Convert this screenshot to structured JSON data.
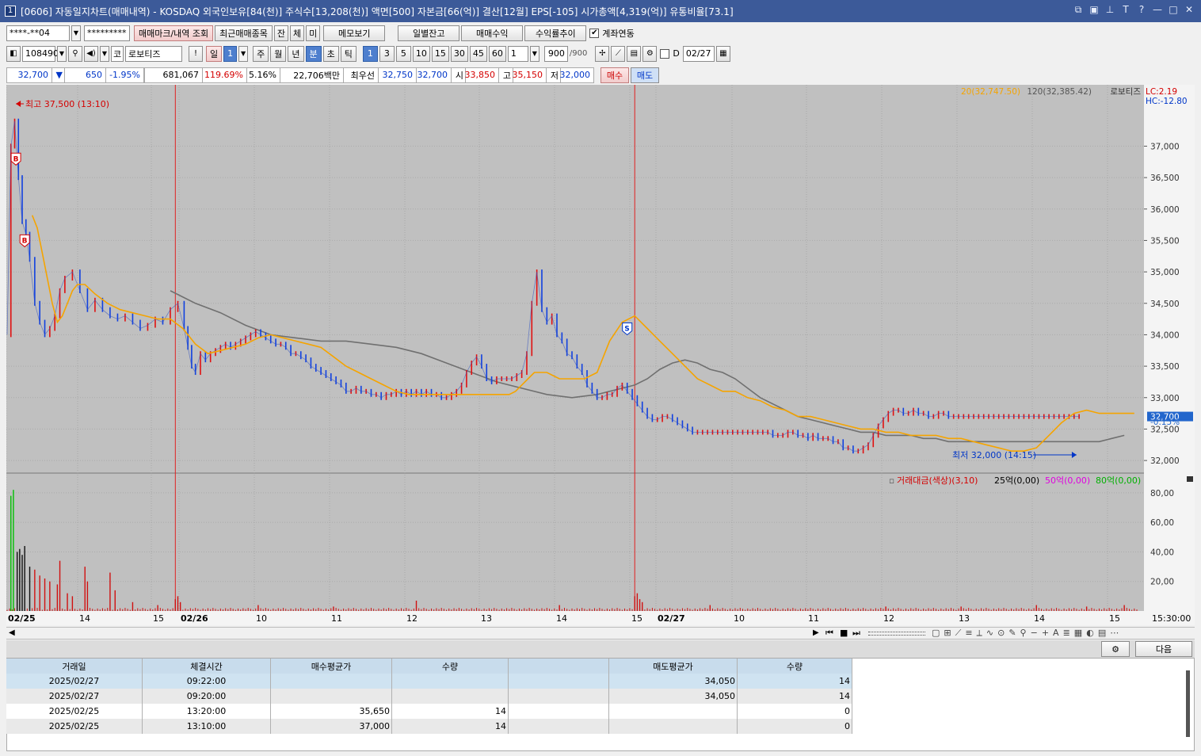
{
  "window": {
    "icon": "1",
    "title": "[0606] 자동일지차트(매매내역) - KOSDAQ 외국인보유[84(천)] 주식수[13,208(천)] 액면[500] 자본금[66(억)] 결산[12월] EPS[-105] 시가총액[4,319(억)] 유통비율[73.1]"
  },
  "toolbar1": {
    "account": "****-**04",
    "password": "*********",
    "mark_btn": "매매마크/내역 조회",
    "recent_btn": "최근매매종목",
    "jan": "잔",
    "che": "체",
    "mi": "미",
    "memo_btn": "메모보기",
    "daily_btn": "일별잔고",
    "profit_btn": "매매수익",
    "rate_btn": "수익률추이",
    "link_check": "✔",
    "link_label": "계좌연동"
  },
  "toolbar2": {
    "code": "108490",
    "market": "코",
    "name": "로보티즈",
    "excl": "!",
    "period_day": "일",
    "period_num": "1",
    "week": "주",
    "month": "월",
    "year": "년",
    "minute": "분",
    "second": "초",
    "tick": "틱",
    "intervals": [
      "1",
      "3",
      "5",
      "10",
      "15",
      "30",
      "45",
      "60"
    ],
    "multi": "1",
    "count": "900",
    "count_max": "/900",
    "d_label": "D",
    "date": "02/27"
  },
  "quote": {
    "price": "32,700",
    "arrow": "▼",
    "change": "650",
    "rate": "-1.95%",
    "volume": "681,067",
    "vol_rate": "119.69%",
    "turnover": "5.16%",
    "amount": "22,706백만",
    "best_label": "최우선",
    "ask": "32,750",
    "bid": "32,700",
    "open_label": "시",
    "open": "33,850",
    "high_label": "고",
    "high": "35,150",
    "low_label": "저",
    "low": "32,000",
    "buy_btn": "매수",
    "sell_btn": "매도"
  },
  "chart_data": {
    "type": "line",
    "title": "",
    "legend": {
      "ma20": "20(32,747.50)",
      "ma120": "120(32,385.42)",
      "name": "로보티즈",
      "lc": "LC:2.19",
      "hc": "HC:-12.80"
    },
    "high_label": "최고 37,500 (13:10)",
    "low_label": "최저 32,000 (14:15)",
    "y_ticks": [
      "37,000",
      "36,500",
      "36,000",
      "35,500",
      "35,000",
      "34,500",
      "34,000",
      "33,500",
      "33,000",
      "32,500",
      "32,000"
    ],
    "y_values": [
      37000,
      36500,
      36000,
      35500,
      35000,
      34500,
      34000,
      33500,
      33000,
      32500,
      32000
    ],
    "ylim": [
      31850,
      37850
    ],
    "current_price_tag": "32,700",
    "current_change_tag": "-0.15%",
    "x_labels": [
      "02/25",
      "14",
      "15",
      "02/26",
      "10",
      "11",
      "12",
      "13",
      "14",
      "15",
      "02/27",
      "10",
      "11",
      "12",
      "13",
      "14",
      "15",
      "15:30:00"
    ],
    "price_series": {
      "t": [
        0,
        3,
        6,
        9,
        12,
        15,
        18,
        22,
        26,
        30,
        34,
        38,
        42,
        46,
        52,
        58,
        64,
        70,
        76,
        82,
        88,
        94,
        100,
        106,
        112,
        118,
        124,
        130,
        136,
        141,
        144,
        147,
        150,
        154,
        158,
        162,
        166,
        170,
        174,
        178,
        182,
        186,
        190,
        194,
        198,
        202,
        206,
        210,
        214,
        218,
        222,
        226,
        230,
        234,
        238,
        242,
        246,
        250,
        254,
        258,
        262,
        266,
        270,
        274,
        278,
        282,
        286,
        290,
        294,
        298,
        302,
        306,
        310,
        314,
        318,
        322,
        326,
        330,
        334,
        338,
        342,
        346,
        350,
        354,
        358,
        362,
        366,
        370,
        374,
        378,
        382,
        386,
        390,
        394,
        398,
        402,
        406,
        410,
        414,
        418,
        422,
        426,
        430,
        434,
        438,
        442,
        446,
        450,
        454,
        458,
        462,
        466,
        470,
        474,
        478,
        482,
        486,
        490,
        494,
        498,
        502,
        506,
        510,
        514,
        518,
        522,
        526,
        530,
        534,
        538,
        542,
        546,
        550,
        554,
        558,
        562,
        566,
        570,
        574,
        578,
        582,
        586,
        590,
        594,
        598,
        602,
        606,
        610,
        614,
        618,
        622,
        626,
        630,
        634,
        638,
        642,
        646,
        650,
        654,
        658,
        662,
        666,
        670,
        674,
        678,
        682,
        686,
        690,
        694,
        698,
        702,
        706,
        710,
        714,
        718,
        722,
        726,
        730,
        734,
        738,
        742,
        746,
        750,
        754,
        758,
        762,
        766,
        770,
        774,
        778,
        782,
        786,
        790,
        794,
        798,
        802,
        806,
        810,
        814,
        818,
        822,
        826,
        830,
        834,
        838,
        842,
        846,
        850,
        854,
        858,
        862,
        866,
        870,
        874,
        878,
        882,
        886,
        890,
        894,
        898
      ],
      "v": [
        34000,
        37000,
        37400,
        36500,
        35800,
        35600,
        35200,
        34500,
        34200,
        34000,
        34100,
        34300,
        34700,
        34900,
        35000,
        34700,
        34400,
        34550,
        34400,
        34300,
        34250,
        34300,
        34200,
        34100,
        34150,
        34250,
        34200,
        34400,
        34500,
        34100,
        33800,
        33500,
        33400,
        33700,
        33600,
        33700,
        33750,
        33800,
        33850,
        33800,
        33850,
        33900,
        33950,
        34000,
        34050,
        34000,
        33950,
        33900,
        33850,
        33850,
        33800,
        33700,
        33700,
        33650,
        33600,
        33500,
        33450,
        33400,
        33350,
        33300,
        33250,
        33200,
        33100,
        33100,
        33150,
        33100,
        33100,
        33050,
        33050,
        33000,
        33050,
        33050,
        33100,
        33050,
        33100,
        33050,
        33100,
        33050,
        33100,
        33050,
        33050,
        33000,
        33000,
        33050,
        33100,
        33200,
        33400,
        33550,
        33650,
        33500,
        33300,
        33250,
        33300,
        33300,
        33300,
        33300,
        33350,
        33400,
        33700,
        34500,
        35000,
        34400,
        34200,
        34300,
        34000,
        33900,
        33700,
        33650,
        33500,
        33400,
        33200,
        33100,
        33000,
        33000,
        33050,
        33050,
        33150,
        33200,
        33100,
        33000,
        32900,
        32800,
        32700,
        32650,
        32650,
        32700,
        32700,
        32650,
        32600,
        32550,
        32500,
        32450,
        32450,
        32450,
        32450,
        32450,
        32450,
        32450,
        32450,
        32450,
        32450,
        32450,
        32450,
        32450,
        32450,
        32450,
        32450,
        32400,
        32400,
        32400,
        32450,
        32450,
        32400,
        32400,
        32350,
        32400,
        32350,
        32350,
        32350,
        32300,
        32300,
        32200,
        32200,
        32150,
        32150,
        32200,
        32250,
        32400,
        32550,
        32650,
        32750,
        32800,
        32800,
        32750,
        32750,
        32800,
        32750,
        32750,
        32700,
        32700,
        32750,
        32750,
        32700,
        32700,
        32700,
        32700,
        32700,
        32700,
        32700,
        32700,
        32700,
        32700,
        32700,
        32700,
        32700,
        32700,
        32700,
        32700,
        32700,
        32700,
        32700,
        32700,
        32700,
        32700,
        32700,
        32700,
        32700,
        32700,
        32700
      ]
    },
    "ma20": {
      "t": [
        20,
        24,
        28,
        32,
        36,
        40,
        44,
        48,
        52,
        56,
        62,
        70,
        80,
        90,
        100,
        110,
        120,
        130,
        140,
        150,
        160,
        170,
        180,
        190,
        200,
        210,
        220,
        230,
        240,
        250,
        260,
        270,
        280,
        290,
        300,
        310,
        320,
        330,
        340,
        350,
        360,
        370,
        380,
        390,
        400,
        405,
        410,
        415,
        420,
        425,
        430,
        435,
        440,
        445,
        450,
        455,
        460,
        470,
        480,
        490,
        500,
        510,
        520,
        530,
        540,
        550,
        560,
        570,
        580,
        590,
        600,
        610,
        620,
        630,
        640,
        650,
        660,
        670,
        680,
        690,
        700,
        710,
        720,
        730,
        740,
        750,
        760,
        770,
        780,
        790,
        800,
        810,
        820,
        830,
        840,
        850,
        860,
        870,
        880,
        890,
        898
      ],
      "v": [
        35900,
        35700,
        35300,
        34900,
        34500,
        34200,
        34300,
        34500,
        34700,
        34800,
        34800,
        34650,
        34500,
        34400,
        34350,
        34300,
        34250,
        34250,
        34100,
        33850,
        33700,
        33750,
        33800,
        33850,
        33950,
        34000,
        33950,
        33900,
        33850,
        33800,
        33650,
        33500,
        33400,
        33300,
        33200,
        33100,
        33050,
        33050,
        33050,
        33050,
        33050,
        33050,
        33050,
        33050,
        33050,
        33100,
        33200,
        33300,
        33400,
        33400,
        33400,
        33350,
        33300,
        33300,
        33300,
        33300,
        33300,
        33400,
        33900,
        34200,
        34300,
        34100,
        33900,
        33700,
        33500,
        33300,
        33200,
        33100,
        33100,
        33000,
        32950,
        32850,
        32800,
        32700,
        32700,
        32650,
        32600,
        32550,
        32500,
        32500,
        32450,
        32450,
        32400,
        32400,
        32400,
        32350,
        32350,
        32300,
        32250,
        32200,
        32150,
        32150,
        32200,
        32400,
        32600,
        32750,
        32800,
        32750,
        32750,
        32750,
        32750
      ]
    },
    "ma120": {
      "t": [
        130,
        150,
        170,
        190,
        210,
        230,
        250,
        270,
        290,
        310,
        330,
        350,
        370,
        390,
        410,
        430,
        450,
        470,
        480,
        490,
        500,
        510,
        520,
        530,
        540,
        550,
        560,
        570,
        580,
        590,
        600,
        610,
        620,
        630,
        640,
        650,
        660,
        670,
        680,
        690,
        700,
        710,
        720,
        730,
        740,
        750,
        760,
        770,
        780,
        790,
        800,
        810,
        820,
        830,
        840,
        850,
        860,
        870,
        880,
        890
      ],
      "v": [
        34700,
        34500,
        34350,
        34150,
        34000,
        33950,
        33900,
        33900,
        33850,
        33800,
        33700,
        33550,
        33400,
        33250,
        33150,
        33050,
        33000,
        33050,
        33100,
        33150,
        33200,
        33300,
        33450,
        33550,
        33600,
        33550,
        33450,
        33400,
        33300,
        33150,
        33000,
        32900,
        32800,
        32700,
        32650,
        32600,
        32550,
        32500,
        32450,
        32450,
        32400,
        32400,
        32400,
        32350,
        32350,
        32300,
        32300,
        32300,
        32300,
        32300,
        32300,
        32300,
        32300,
        32300,
        32300,
        32300,
        32300,
        32300,
        32350,
        32400
      ]
    },
    "markers": [
      {
        "label": "B",
        "t": 7,
        "v": 36800
      },
      {
        "label": "B",
        "t": 14,
        "v": 35500
      },
      {
        "label": "S",
        "t": 494,
        "v": 34100
      }
    ],
    "session_dividers": [
      134,
      500
    ],
    "volume_legend": {
      "box": "▫",
      "name": "거래대금(색상)(3,10)",
      "l25": "25억(0,00)",
      "l50": "50억(0,00)",
      "l80": "80억(0,00)"
    },
    "vol_ticks": [
      "80,00",
      "60,00",
      "40,00",
      "20,00"
    ],
    "vol_tick_values": [
      80,
      60,
      40,
      20
    ],
    "vol_max": 88,
    "volume_spikes": [
      {
        "t": 3,
        "v": 78
      },
      {
        "t": 5,
        "v": 82
      },
      {
        "t": 8,
        "v": 40
      },
      {
        "t": 10,
        "v": 42
      },
      {
        "t": 12,
        "v": 38
      },
      {
        "t": 14,
        "v": 44
      },
      {
        "t": 18,
        "v": 30
      },
      {
        "t": 22,
        "v": 28
      },
      {
        "t": 26,
        "v": 24
      },
      {
        "t": 30,
        "v": 22
      },
      {
        "t": 34,
        "v": 20
      },
      {
        "t": 40,
        "v": 18
      },
      {
        "t": 42,
        "v": 34
      },
      {
        "t": 48,
        "v": 12
      },
      {
        "t": 52,
        "v": 10
      },
      {
        "t": 62,
        "v": 30
      },
      {
        "t": 64,
        "v": 20
      },
      {
        "t": 82,
        "v": 26
      },
      {
        "t": 86,
        "v": 14
      },
      {
        "t": 100,
        "v": 6
      },
      {
        "t": 120,
        "v": 4
      },
      {
        "t": 134,
        "v": 8
      },
      {
        "t": 136,
        "v": 10
      },
      {
        "t": 138,
        "v": 6
      },
      {
        "t": 200,
        "v": 4
      },
      {
        "t": 260,
        "v": 3
      },
      {
        "t": 326,
        "v": 7
      },
      {
        "t": 440,
        "v": 4
      },
      {
        "t": 500,
        "v": 10
      },
      {
        "t": 502,
        "v": 12
      },
      {
        "t": 504,
        "v": 8
      },
      {
        "t": 506,
        "v": 6
      },
      {
        "t": 560,
        "v": 4
      },
      {
        "t": 700,
        "v": 3
      },
      {
        "t": 760,
        "v": 3
      },
      {
        "t": 820,
        "v": 4
      },
      {
        "t": 860,
        "v": 3
      },
      {
        "t": 890,
        "v": 4
      }
    ]
  },
  "nav": {
    "left": "◀",
    "right": "▶"
  },
  "table": {
    "next_btn": "다음",
    "headers": [
      "거래일",
      "체결시간",
      "매수평균가",
      "수량",
      "",
      "매도평균가",
      "수량"
    ],
    "rows": [
      [
        "2025/02/27",
        "09:22:00",
        "",
        "",
        "",
        "34,050",
        "14"
      ],
      [
        "2025/02/27",
        "09:20:00",
        "",
        "",
        "",
        "34,050",
        "14"
      ],
      [
        "2025/02/25",
        "13:20:00",
        "35,650",
        "14",
        "",
        "",
        "0"
      ],
      [
        "2025/02/25",
        "13:10:00",
        "37,000",
        "14",
        "",
        "",
        "0"
      ]
    ]
  }
}
